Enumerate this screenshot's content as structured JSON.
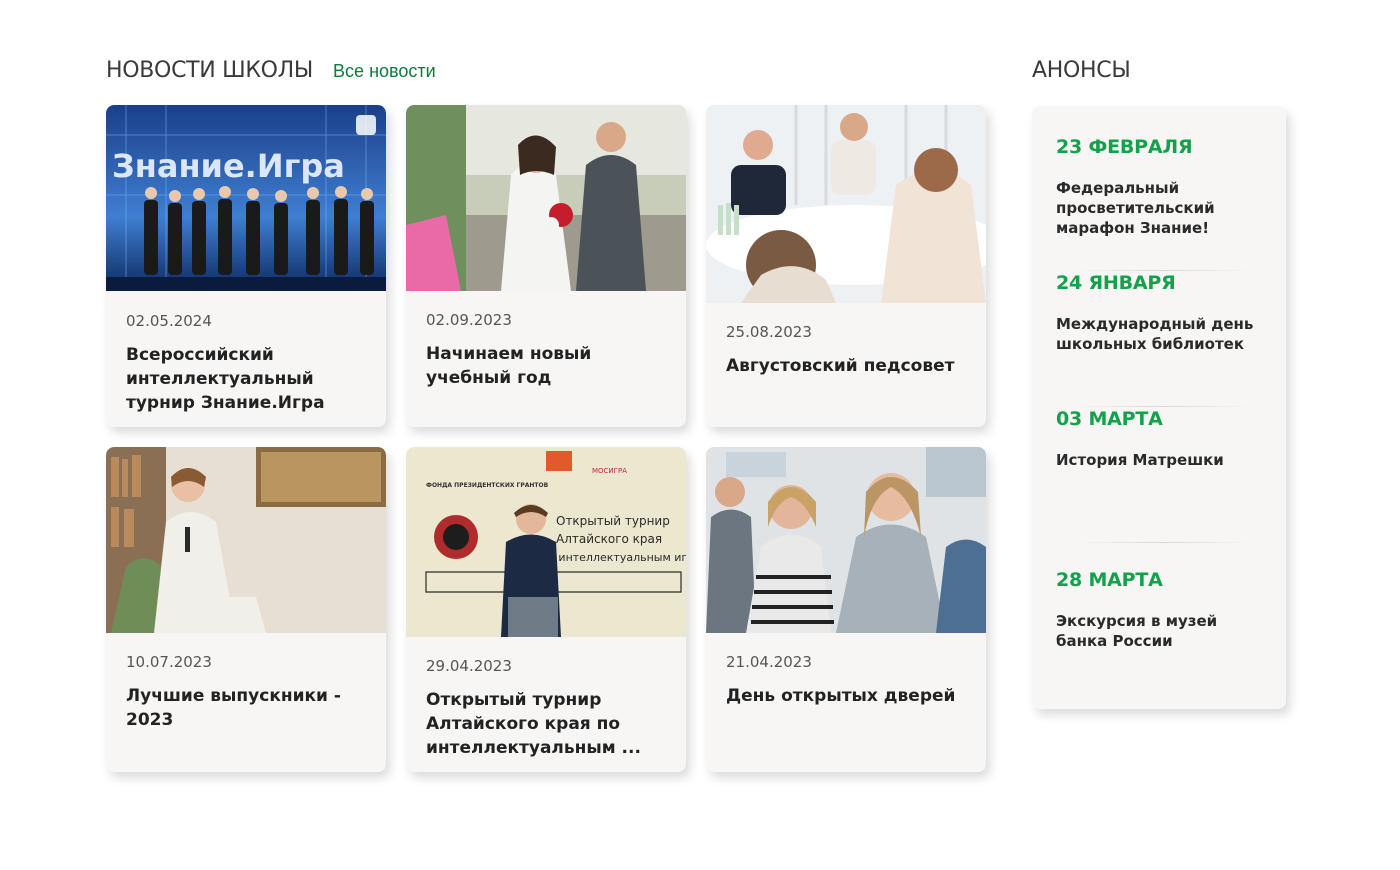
{
  "news": {
    "section_title": "НОВОСТИ ШКОЛЫ",
    "all_news_link": "Все новости",
    "cards": [
      {
        "date": "02.05.2024",
        "title": "Всероссийский интеллектуальный турнир Знание.Игра",
        "photo_text": "Знание.Игра"
      },
      {
        "date": "02.09.2023",
        "title": "Начинаем новый учебный год"
      },
      {
        "date": "25.08.2023",
        "title": "Августовский педсовет"
      },
      {
        "date": "10.07.2023",
        "title": "Лучшие выпускники - 2023"
      },
      {
        "date": "29.04.2023",
        "title": "Открытый турнир Алтайского края по интеллектуальным ...",
        "photo_text": [
          "Открытый турнир",
          "Алтайского края",
          "по интеллектуальным играм",
          "ФОНДА ПРЕЗИДЕНТСКИХ ГРАНТОВ",
          "МОСИГРА"
        ]
      },
      {
        "date": "21.04.2023",
        "title": "День открытых дверей"
      }
    ]
  },
  "announcements": {
    "section_title": "АНОНСЫ",
    "items": [
      {
        "date": "23 февраля",
        "text": "Федеральный просветительский марафон Знание!"
      },
      {
        "date": "24 января",
        "text": "Международный день школьных библиотек"
      },
      {
        "date": "03 марта",
        "text": "История Матрешки"
      },
      {
        "date": "28 марта",
        "text": "Экскурсия в музей банка России"
      }
    ]
  },
  "colors": {
    "accent_green": "#14a14c",
    "link_green": "#0f7a3a",
    "card_bg": "#f7f6f4"
  }
}
